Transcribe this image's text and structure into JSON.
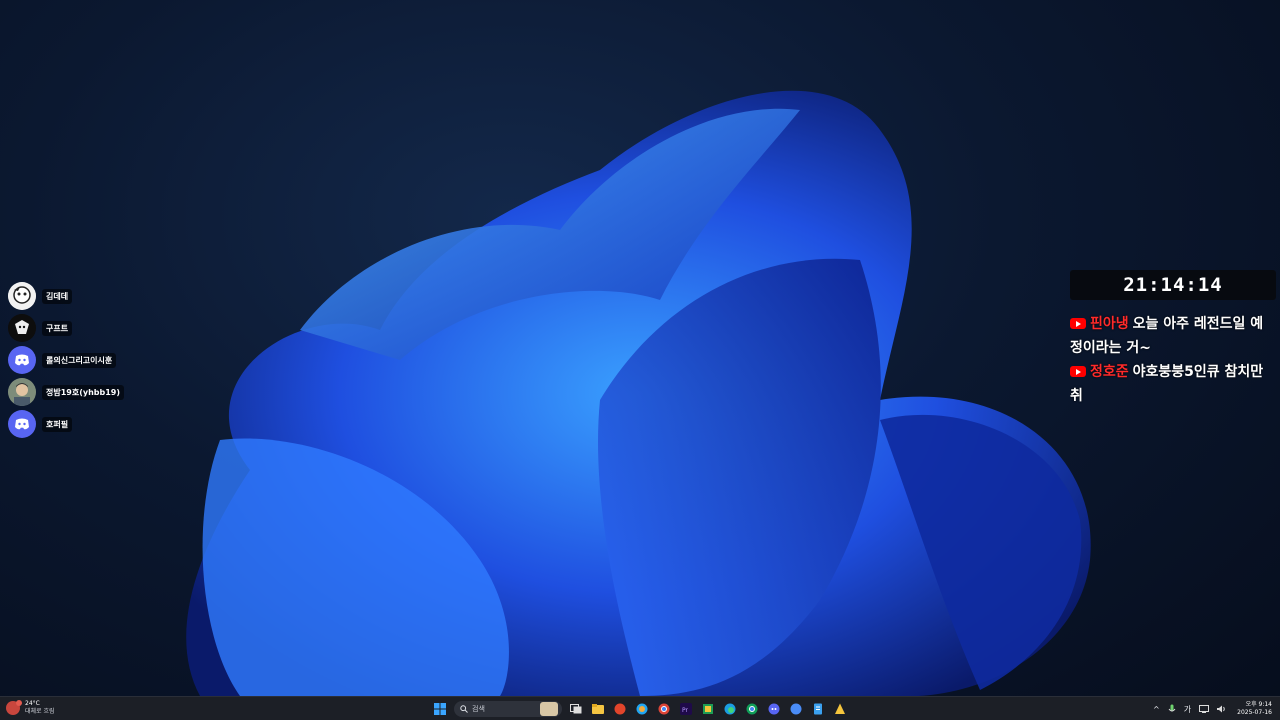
{
  "overlay": {
    "clock": "21:14:14",
    "voice_users": [
      {
        "name": "김데데",
        "avatar": "avatar-face-icon"
      },
      {
        "name": "구프트",
        "avatar": "avatar-character-icon"
      },
      {
        "name": "롤의신그리고이시훈",
        "avatar": "discord-icon"
      },
      {
        "name": "정밤19호(yhbb19)",
        "avatar": "avatar-photo-icon"
      },
      {
        "name": "호퍼필",
        "avatar": "discord-icon"
      }
    ],
    "chat": {
      "messages": [
        {
          "author": "핀아냉",
          "text": "오늘 아주 레전드일 예정이라는 거~"
        },
        {
          "author": "정호준",
          "text": "야호붕붕5인큐 참치만취"
        }
      ]
    }
  },
  "taskbar": {
    "weather": {
      "temp": "24°C",
      "condition": "대체로 흐림"
    },
    "search_placeholder": "검색",
    "pinned_icons": [
      "task-view-icon",
      "file-explorer-icon",
      "app-red-icon",
      "copilot-icon",
      "chrome-icon",
      "premiere-icon",
      "app-green-icon",
      "edge-icon",
      "chrome-badge-icon",
      "discord-icon",
      "app-blue-icon",
      "notes-icon",
      "app-yellow-icon"
    ],
    "tray": {
      "chevron": "^",
      "ime": "가",
      "time": "오후 9:14",
      "date": "2025-07-16"
    }
  },
  "colors": {
    "accent_chat_author": "#ff2a2a",
    "youtube_red": "#ff0000",
    "discord_blurple": "#5865f2",
    "taskbar_bg": "#1c1f26"
  }
}
